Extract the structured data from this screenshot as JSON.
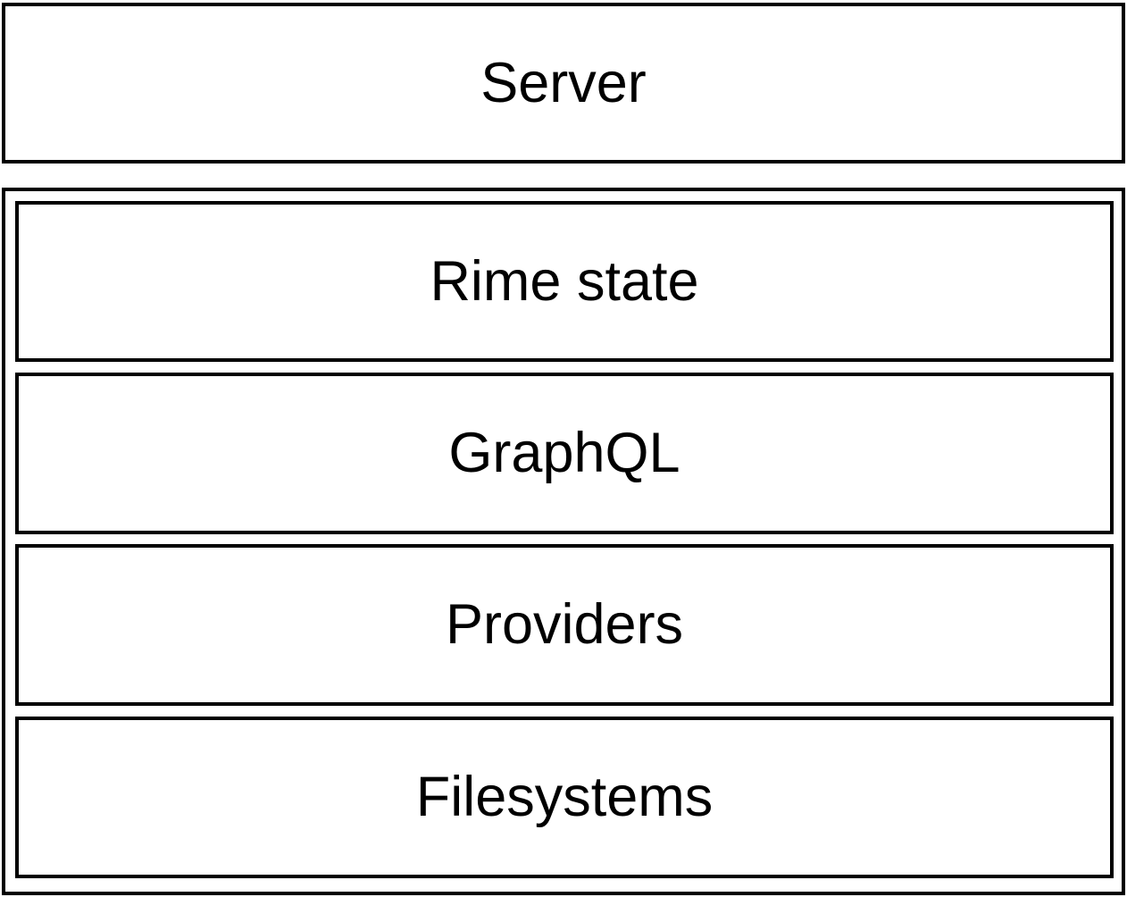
{
  "server": {
    "label": "Server"
  },
  "stack": {
    "layers": [
      {
        "label": "Rime state"
      },
      {
        "label": "GraphQL"
      },
      {
        "label": "Providers"
      },
      {
        "label": "Filesystems"
      }
    ]
  },
  "colors": {
    "stroke": "#000000",
    "fill": "#ffffff",
    "text": "#000000"
  }
}
